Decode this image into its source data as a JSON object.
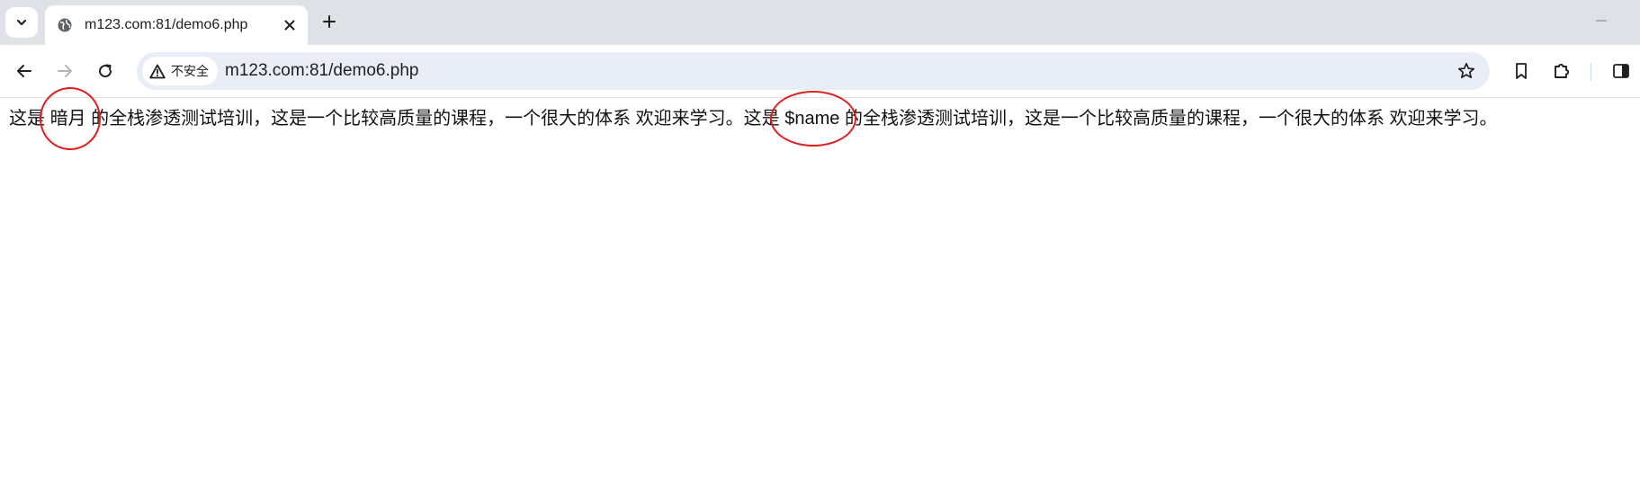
{
  "tab": {
    "title": "m123.com:81/demo6.php"
  },
  "omnibox": {
    "security_label": "不安全",
    "url": "m123.com:81/demo6.php"
  },
  "page": {
    "segment_1": "这是 ",
    "name_value": "暗月",
    "segment_2": " 的全栈渗透测试培训，这是一个比较高质量的课程，一个很大的体系 欢迎来学习。这是 ",
    "name_variable": "$name",
    "segment_3": " 的全栈渗透测试培训，这是一个比较高质量的课程，一个很大的体系 欢迎来学习。"
  },
  "annotations": {
    "circle_color": "#e01e1e"
  },
  "icons": {
    "tab_search": "chevron-down-icon",
    "favicon": "globe-icon",
    "tab_close": "close-icon",
    "new_tab": "plus-icon",
    "minimize": "minimize-icon",
    "back": "arrow-left-icon",
    "forward": "arrow-right-icon",
    "reload": "reload-icon",
    "not_secure": "warning-triangle-icon",
    "bookmark_star": "star-icon",
    "bookmarks": "bookmark-icon",
    "extensions": "puzzle-icon",
    "side_panel": "side-panel-icon"
  },
  "colors": {
    "tabstrip_bg": "#dee1e6",
    "omnibox_bg": "#e9eef6",
    "forward_disabled": "#b0b4ba"
  }
}
